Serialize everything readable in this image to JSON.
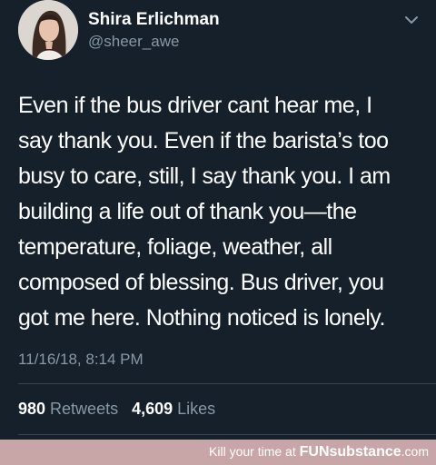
{
  "author": {
    "display_name": "Shira Erlichman",
    "handle": "@sheer_awe"
  },
  "tweet": {
    "text": "Even if the bus driver cant hear me, I\nsay thank you. Even if the barista’s too\nbusy to care, still, I say thank you. I am\nbuilding a life out of thank you—the\ntemperature, foliage, weather, all\ncomposed of blessing. Bus driver, you\ngot me here. Nothing noticed is lonely.",
    "timestamp": "11/16/18, 8:14 PM"
  },
  "stats": {
    "retweets_count": "980",
    "retweets_label": "Retweets",
    "likes_count": "4,609",
    "likes_label": "Likes"
  },
  "watermark": {
    "prefix": "Kill your time at",
    "brand": "FUNsubstance",
    "suffix": ".com"
  },
  "colors": {
    "background": "#15202b",
    "primary_text": "#ffffff",
    "secondary_text": "#8899a6",
    "divider": "#38444d",
    "watermark_bar": "#c8a5a7"
  },
  "icons": {
    "menu": "chevron-down-icon"
  }
}
